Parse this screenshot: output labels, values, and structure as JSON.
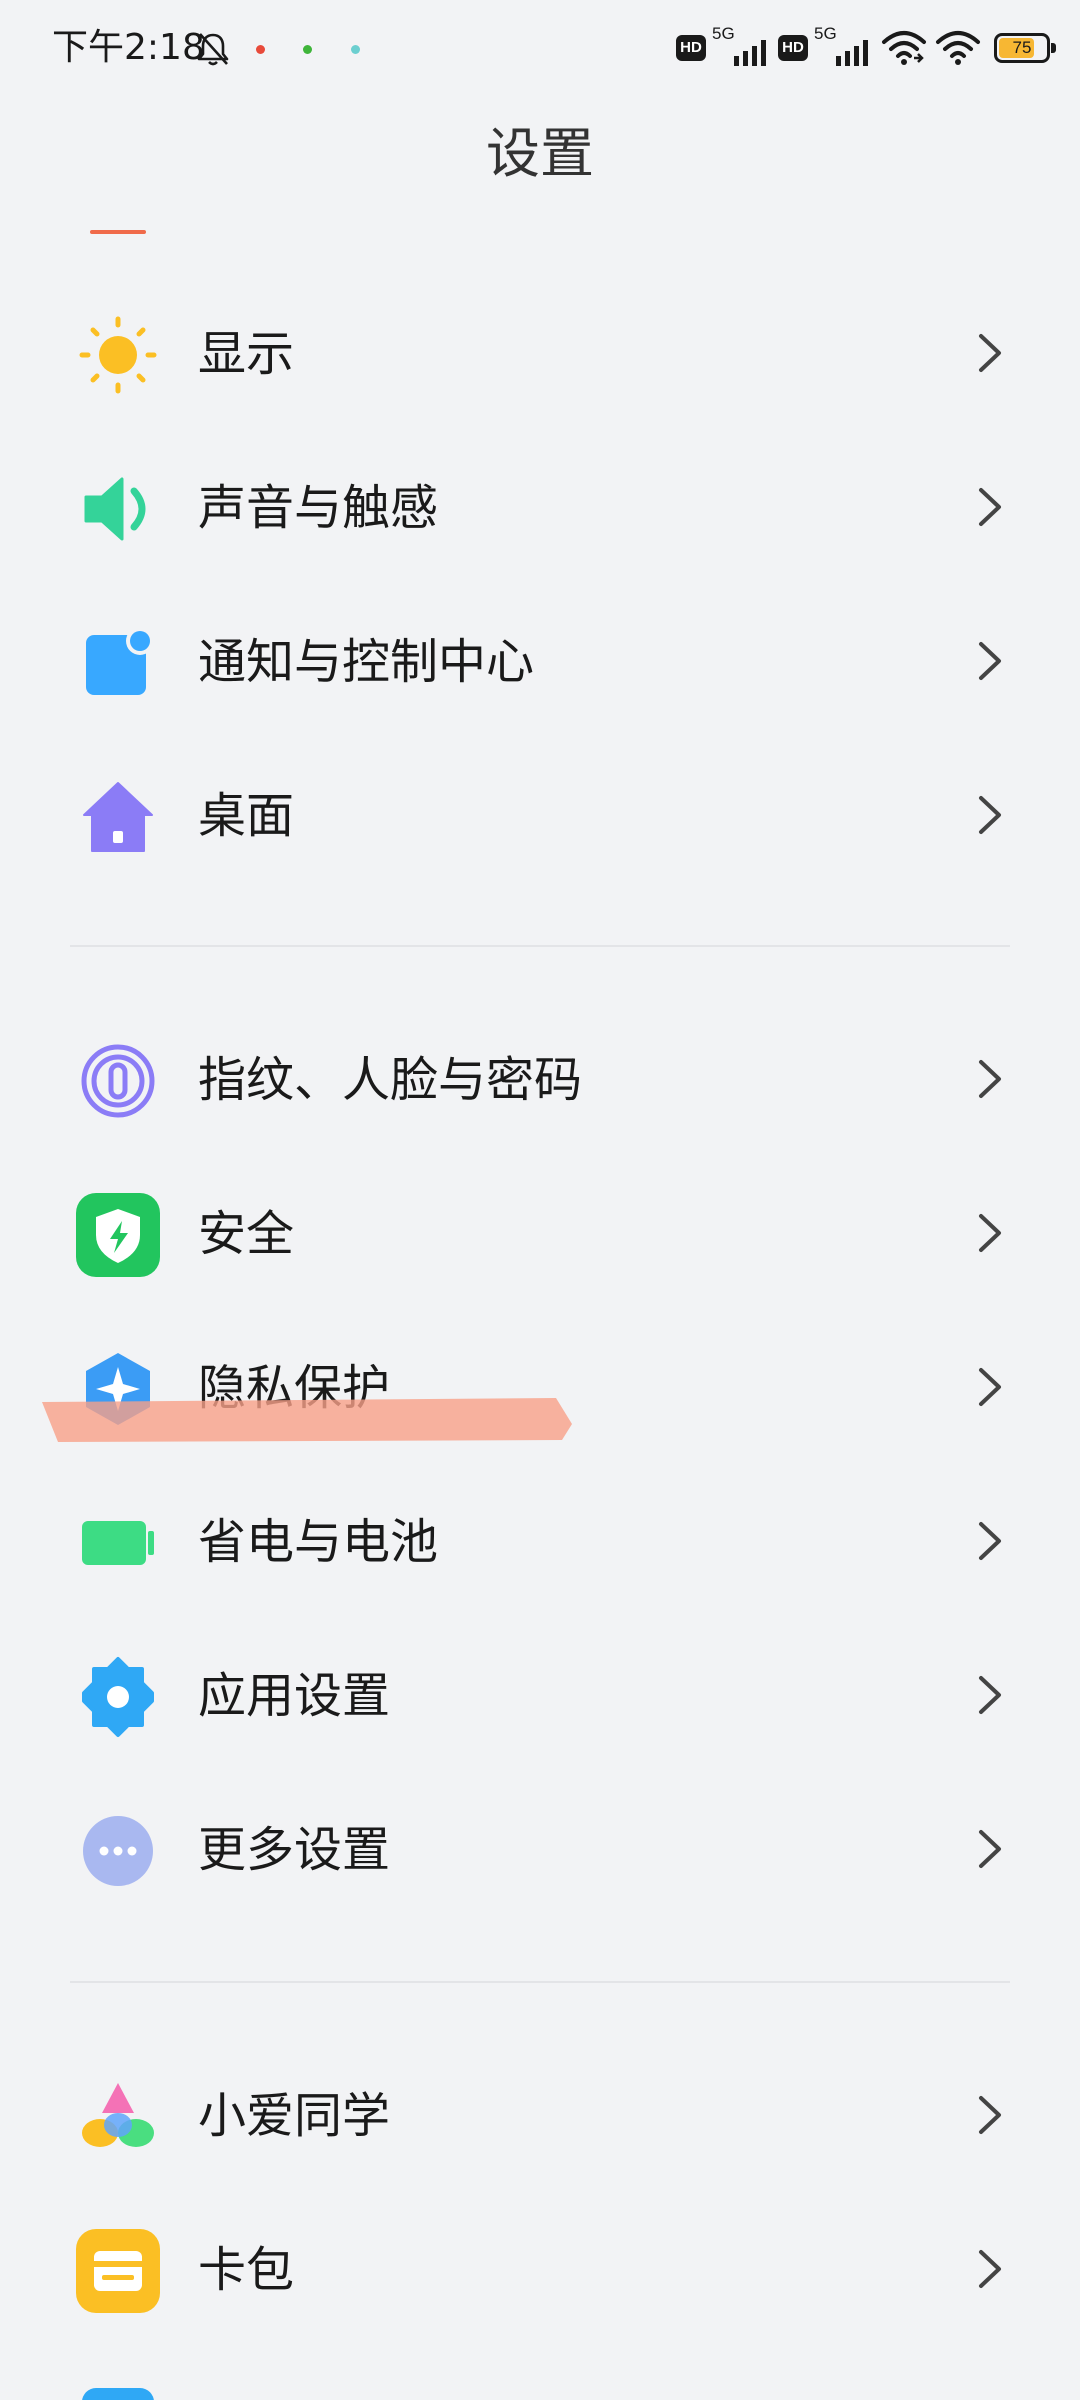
{
  "status_bar": {
    "time": "下午2:18",
    "network_1": "5G",
    "network_2": "5G",
    "battery_level": "75",
    "battery_fraction": 0.75,
    "hd_label": "HD"
  },
  "header": {
    "title": "设置"
  },
  "settings": {
    "group1": [
      {
        "label": "显示",
        "icon": "sun-icon",
        "color": "#fbbf24"
      },
      {
        "label": "声音与触感",
        "icon": "speaker-icon",
        "color": "#34d399"
      },
      {
        "label": "通知与控制中心",
        "icon": "notification-icon",
        "color": "#38a8ff"
      },
      {
        "label": "桌面",
        "icon": "home-icon",
        "color": "#8b7cf6"
      }
    ],
    "group2": [
      {
        "label": "指纹、人脸与密码",
        "icon": "fingerprint-icon",
        "color": "#8b7cf6"
      },
      {
        "label": "安全",
        "icon": "shield-icon",
        "color": "#22c55e"
      },
      {
        "label": "隐私保护",
        "icon": "privacy-icon",
        "color": "#3b9cf5"
      },
      {
        "label": "省电与电池",
        "icon": "battery-icon",
        "color": "#3ddc84"
      },
      {
        "label": "应用设置",
        "icon": "gear-icon",
        "color": "#2fa8f5"
      },
      {
        "label": "更多设置",
        "icon": "more-icon",
        "color": "#a9b8f0"
      }
    ],
    "group3": [
      {
        "label": "小爱同学",
        "icon": "xiaoai-icon",
        "color": "#f472b6"
      },
      {
        "label": "卡包",
        "icon": "wallet-icon",
        "color": "#fbbf24"
      }
    ]
  }
}
